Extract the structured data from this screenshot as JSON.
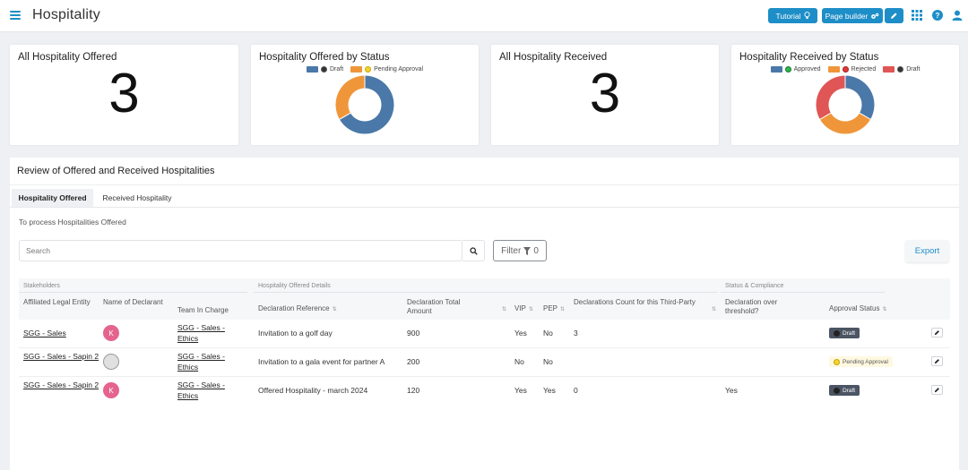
{
  "header": {
    "title": "Hospitality",
    "tutorial_label": "Tutorial",
    "page_builder_label": "Page builder"
  },
  "colors": {
    "accent": "#1d8ec7",
    "series_blue": "#4a78a8",
    "series_orange": "#f0963a",
    "series_red": "#e05555"
  },
  "cards": {
    "offered_total": {
      "title": "All Hospitality Offered",
      "value": "3"
    },
    "offered_by_status": {
      "title": "Hospitality Offered by Status",
      "legend": [
        "Draft",
        "Pending Approval"
      ]
    },
    "received_total": {
      "title": "All Hospitality Received",
      "value": "3"
    },
    "received_by_status": {
      "title": "Hospitality Received by Status",
      "legend": [
        "Approved",
        "Rejected",
        "Draft"
      ]
    }
  },
  "chart_data": [
    {
      "type": "pie",
      "title": "Hospitality Offered by Status",
      "categories": [
        "Draft",
        "Pending Approval"
      ],
      "values": [
        2,
        1
      ],
      "colors": [
        "#4a78a8",
        "#f0963a"
      ]
    },
    {
      "type": "pie",
      "title": "Hospitality Received by Status",
      "categories": [
        "Approved",
        "Rejected",
        "Draft"
      ],
      "values": [
        1,
        1,
        1
      ],
      "colors": [
        "#4a78a8",
        "#f0963a",
        "#e05555"
      ]
    }
  ],
  "review": {
    "title": "Review of Offered and Received Hospitalities",
    "tabs": [
      "Hospitality Offered",
      "Received Hospitality"
    ],
    "subheading": "To process Hospitalities Offered",
    "search_placeholder": "Search",
    "filter_label": "Filter",
    "filter_count": "0",
    "export_label": "Export",
    "groups": [
      "Stakeholders",
      "Hospitality Offered Details",
      "Status & Compliance"
    ],
    "columns": {
      "entity": "Affiliated Legal Entity",
      "declarant": "Name of Declarant",
      "team": "Team In Charge",
      "reference": "Declaration Reference",
      "amount": "Declaration Total Amount",
      "vip": "VIP",
      "pep": "PEP",
      "count": "Declarations Count for this Third-Party",
      "threshold": "Declaration over threshold?",
      "approval": "Approval Status"
    },
    "rows": [
      {
        "entity": "SGG - Sales",
        "declarant": "K",
        "team": "SGG - Sales - Ethics",
        "reference": "Invitation to a golf day",
        "amount": "900",
        "vip": "Yes",
        "pep": "No",
        "count": "3",
        "threshold": "",
        "status": "Draft"
      },
      {
        "entity": "SGG - Sales - Sapin 2",
        "declarant": "",
        "team": "SGG - Sales - Ethics",
        "reference": "Invitation to a gala event for partner A",
        "amount": "200",
        "vip": "No",
        "pep": "No",
        "count": "",
        "threshold": "",
        "status": "Pending Approval"
      },
      {
        "entity": "SGG - Sales - Sapin 2",
        "declarant": "K",
        "team": "SGG - Sales - Ethics",
        "reference": "Offered Hospitality - march 2024",
        "amount": "120",
        "vip": "Yes",
        "pep": "Yes",
        "count": "0",
        "threshold": "Yes",
        "status": "Draft"
      }
    ]
  }
}
